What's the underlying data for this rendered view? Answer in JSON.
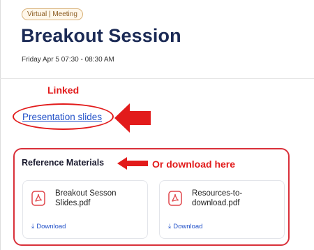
{
  "event": {
    "badge": "Virtual | Meeting",
    "title": "Breakout Session",
    "datetime": "Friday Apr 5 07:30 - 08:30 AM"
  },
  "annotations": {
    "linked": "Linked",
    "download_here": "Or download here",
    "color": "#e21b1b"
  },
  "link": {
    "label": "Presentation slides"
  },
  "reference": {
    "title": "Reference Materials",
    "files": [
      {
        "name": "Breakout Sesson Slides.pdf",
        "download_label": "Download",
        "icon": "pdf-file-icon"
      },
      {
        "name": "Resources-to-download.pdf",
        "download_label": "Download",
        "icon": "pdf-file-icon"
      }
    ]
  },
  "colors": {
    "title": "#1b2a55",
    "link": "#2352c9",
    "badge_border": "#d9b27a"
  }
}
